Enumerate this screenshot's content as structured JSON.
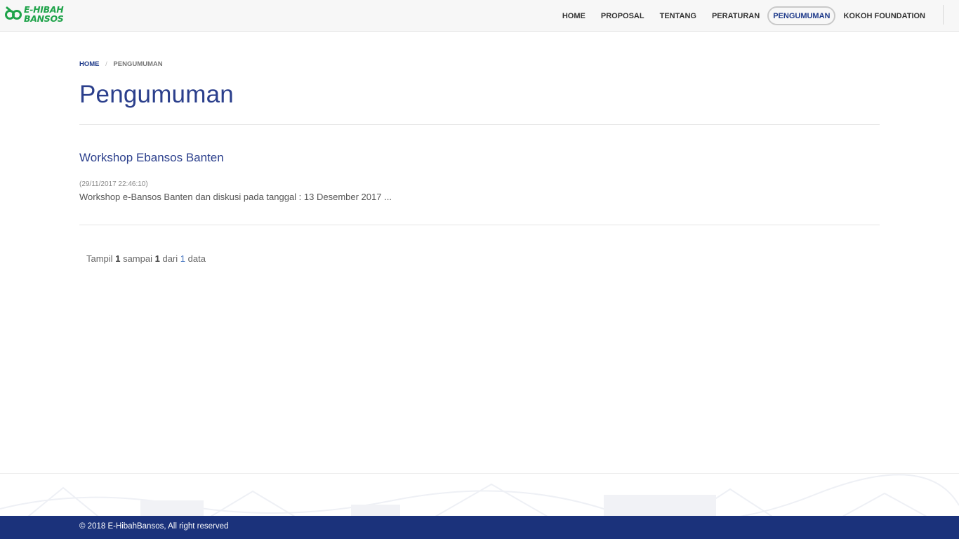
{
  "header": {
    "logo_line1": "E-HIBAH",
    "logo_line2": "BANSOS",
    "nav": [
      {
        "label": "HOME"
      },
      {
        "label": "PROPOSAL"
      },
      {
        "label": "TENTANG"
      },
      {
        "label": "PERATURAN"
      },
      {
        "label": "PENGUMUMAN",
        "active": true
      },
      {
        "label": "KOKOH FOUNDATION"
      }
    ]
  },
  "breadcrumb": {
    "home": "HOME",
    "separator": "/",
    "current": "PENGUMUMAN"
  },
  "page": {
    "title": "Pengumuman"
  },
  "posts": [
    {
      "title": "Workshop Ebansos Banten",
      "date": "(29/11/2017 22:46:10)",
      "excerpt": "Workshop e-Bansos Banten dan diskusi pada tanggal : 13 Desember 2017 ..."
    }
  ],
  "pagination": {
    "prefix": "Tampil",
    "from": "1",
    "to_label": "sampai",
    "to": "1",
    "of_label": "dari",
    "total": "1",
    "suffix": "data"
  },
  "footer": {
    "copyright": "© 2018 E-HibahBansos, All right reserved"
  },
  "colors": {
    "brand_green": "#1fa34a",
    "primary_blue": "#2b3f8c",
    "footer_blue": "#1b327b"
  }
}
